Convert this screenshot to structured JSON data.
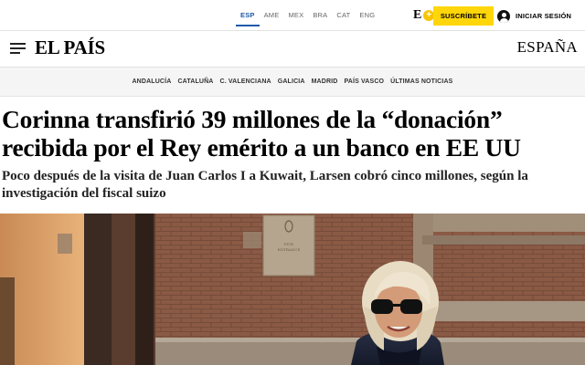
{
  "topbar": {
    "editions": [
      "ESP",
      "AME",
      "MEX",
      "BRA",
      "CAT",
      "ENG"
    ],
    "active_edition": "ESP",
    "eplus_letter": "E",
    "eplus_icon": "plus-badge-icon",
    "subscribe_label": "SUSCRÍBETE",
    "login_icon": "user-avatar-icon",
    "login_label": "INICIAR SESIÓN"
  },
  "masthead": {
    "menu_icon": "hamburger-menu-icon",
    "logo": "EL PAÍS",
    "section": "ESPAÑA"
  },
  "regions": [
    "ANDALUCÍA",
    "CATALUÑA",
    "C. VALENCIANA",
    "GALICIA",
    "MADRID",
    "PAÍS VASCO",
    "ÚLTIMAS NOTICIAS"
  ],
  "article": {
    "headline": "Corinna transfirió 39 millones de la “donación” recibida por el Rey emérito a un banco en EE UU",
    "subtitle": "Poco después de la visita de Juan Carlos I a Kuwait, Larsen cobró cinco millones, según la investigación del fiscal suizo"
  },
  "photo": {
    "plaque_line1": "ENTRANCE",
    "colors": {
      "brick": "#8a5a45",
      "stone": "#b5a48e",
      "door": "#3a2a22",
      "coat": "#1d2235",
      "hair": "#e8dcc4"
    }
  },
  "colors": {
    "accent_blue": "#1c5aa8",
    "subscribe_yellow": "#ffd60a",
    "nav_bg": "#f5f5f5"
  }
}
